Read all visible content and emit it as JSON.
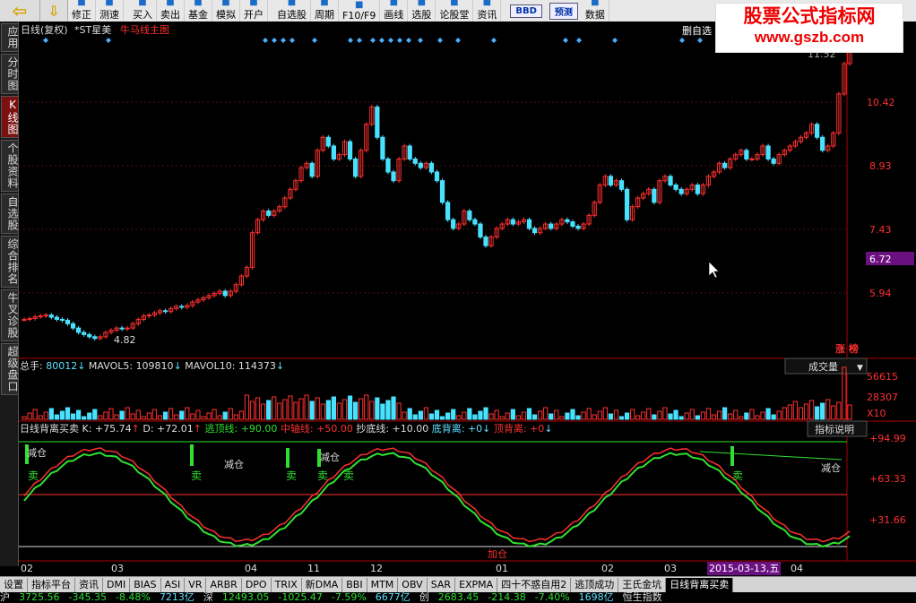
{
  "toolbar": {
    "buttons": [
      {
        "label": "修正",
        "icon": "edit-icon"
      },
      {
        "label": "测速",
        "icon": "speed-icon"
      },
      {
        "label": "买入",
        "icon": "buy-icon"
      },
      {
        "label": "卖出",
        "icon": "sell-icon"
      },
      {
        "label": "基金",
        "icon": "fund-icon"
      },
      {
        "label": "模拟",
        "icon": "simulate-icon"
      },
      {
        "label": "开户",
        "icon": "account-icon"
      },
      {
        "label": "自选股",
        "icon": "watchlist-icon"
      },
      {
        "label": "周期",
        "icon": "period-icon"
      },
      {
        "label": "F10/F9",
        "icon": "f10-icon"
      },
      {
        "label": "画线",
        "icon": "draw-icon"
      },
      {
        "label": "选股",
        "icon": "screen-icon"
      },
      {
        "label": "论股堂",
        "icon": "forum-icon"
      },
      {
        "label": "资讯",
        "icon": "news-icon"
      },
      {
        "label": "BBD",
        "icon": "bbd-icon"
      },
      {
        "label": "预测",
        "icon": "forecast-icon"
      },
      {
        "label": "数据",
        "icon": "data-icon"
      }
    ]
  },
  "logo": {
    "line1": "股票公式指标网",
    "line2": "www.gszb.com"
  },
  "sidebar": {
    "items": [
      {
        "label": "应用",
        "active": false
      },
      {
        "label": "分时图",
        "active": false
      },
      {
        "label": "K线图",
        "active": true
      },
      {
        "label": "个股资料",
        "active": false
      },
      {
        "label": "自选股",
        "active": false
      },
      {
        "label": "综合排名",
        "active": false
      },
      {
        "label": "牛叉诊股",
        "active": false
      },
      {
        "label": "超级盘口",
        "active": false
      }
    ]
  },
  "main": {
    "header_left": "日线(复权)",
    "stock_name": "*ST星美",
    "indicator_name": "牛马线主图",
    "header_right": "删自选",
    "price_labels": [
      "10.42",
      "8.93",
      "7.43",
      "5.94"
    ],
    "current_price": "6.72",
    "low_marker": "4.82",
    "high_marker": "11.52",
    "zhangbang": "涨 榜"
  },
  "volume": {
    "total_label": "总手",
    "total": "80012",
    "mavol5_label": "MAVOL5",
    "mavol5": "109810",
    "mavol10_label": "MAVOL10",
    "mavol10": "114373",
    "dropdown": "成交量",
    "axis": [
      "56615",
      "28307",
      "X10"
    ]
  },
  "indicator": {
    "name": "日线背离买卖",
    "k_label": "K",
    "k": "+75.74",
    "d_label": "D",
    "d": "+72.01",
    "escape_label": "逃顶线",
    "escape": "+90.00",
    "mid_label": "中轴线",
    "mid": "+50.00",
    "bottom_label": "抄底线",
    "bottom": "+10.00",
    "div_bottom_label": "底背离",
    "div_bottom": "+0",
    "div_top_label": "顶背离",
    "div_top": "+0",
    "help": "指标说明",
    "axis": [
      "+94.99",
      "+63.33",
      "+31.66"
    ],
    "annotations": [
      "减仓",
      "卖",
      "卖",
      "减仓",
      "卖",
      "卖",
      "减仓",
      "卖",
      "加仓",
      "卖",
      "减仓"
    ]
  },
  "time_axis": {
    "labels": [
      "02",
      "03",
      "04",
      "11",
      "12",
      "01",
      "02",
      "03",
      "04"
    ],
    "highlight": "2015-03-13,五"
  },
  "bottom_tabs": [
    "设置",
    "指标平台",
    "资讯",
    "DMI",
    "BIAS",
    "ASI",
    "VR",
    "ARBR",
    "DPO",
    "TRIX",
    "新DMA",
    "BBI",
    "MTM",
    "OBV",
    "SAR",
    "EXPMA",
    "四十不惑自用2",
    "逃顶成功",
    "王氏金坑",
    "日线背离买卖"
  ],
  "status": [
    {
      "text": "沪",
      "cls": ""
    },
    {
      "text": "3725.56",
      "cls": "dn"
    },
    {
      "text": "-345.35",
      "cls": "dn"
    },
    {
      "text": "-8.48%",
      "cls": "dn"
    },
    {
      "text": "7213亿",
      "cls": "cy"
    },
    {
      "text": "深",
      "cls": ""
    },
    {
      "text": "12493.05",
      "cls": "dn"
    },
    {
      "text": "-1025.47",
      "cls": "dn"
    },
    {
      "text": "-7.59%",
      "cls": "dn"
    },
    {
      "text": "6677亿",
      "cls": "cy"
    },
    {
      "text": "创",
      "cls": ""
    },
    {
      "text": "2683.45",
      "cls": "dn"
    },
    {
      "text": "-214.38",
      "cls": "dn"
    },
    {
      "text": "-7.40%",
      "cls": "dn"
    },
    {
      "text": "1698亿",
      "cls": "cy"
    },
    {
      "text": "恒生指数",
      "cls": ""
    }
  ],
  "colors": {
    "up": "#ff3030",
    "down": "#48e2ff",
    "axis": "#aa0000",
    "kline": "#ff3030",
    "dline": "#30e030"
  },
  "chart_data": {
    "type": "candlestick",
    "price_range": [
      4.4,
      11.8
    ],
    "closes": [
      5.3,
      5.32,
      5.36,
      5.38,
      5.4,
      5.35,
      5.3,
      5.28,
      5.2,
      5.1,
      5.0,
      4.95,
      4.9,
      4.86,
      4.9,
      5.0,
      5.05,
      5.1,
      5.08,
      5.1,
      5.2,
      5.3,
      5.38,
      5.4,
      5.45,
      5.5,
      5.48,
      5.55,
      5.6,
      5.58,
      5.62,
      5.7,
      5.75,
      5.8,
      5.85,
      5.9,
      5.95,
      5.85,
      5.95,
      6.1,
      6.3,
      6.5,
      7.3,
      7.6,
      7.8,
      7.7,
      7.8,
      7.9,
      8.1,
      8.3,
      8.5,
      8.8,
      8.9,
      8.6,
      9.2,
      9.5,
      9.3,
      9.0,
      9.1,
      9.4,
      9.0,
      8.6,
      9.2,
      9.8,
      10.2,
      9.5,
      9.0,
      8.7,
      8.5,
      9.0,
      9.3,
      9.0,
      8.9,
      8.8,
      8.9,
      8.7,
      8.5,
      8.0,
      7.6,
      7.4,
      7.5,
      7.8,
      7.6,
      7.5,
      7.2,
      7.0,
      7.2,
      7.4,
      7.5,
      7.6,
      7.5,
      7.55,
      7.6,
      7.4,
      7.3,
      7.4,
      7.5,
      7.4,
      7.5,
      7.6,
      7.55,
      7.45,
      7.4,
      7.5,
      7.7,
      8.0,
      8.4,
      8.6,
      8.4,
      8.5,
      8.3,
      7.6,
      7.9,
      8.1,
      8.2,
      8.3,
      8.0,
      8.5,
      8.6,
      8.4,
      8.3,
      8.2,
      8.3,
      8.4,
      8.2,
      8.4,
      8.6,
      8.7,
      8.9,
      8.8,
      9.0,
      9.1,
      9.2,
      9.0,
      9.0,
      9.1,
      9.3,
      9.0,
      8.9,
      9.1,
      9.2,
      9.3,
      9.4,
      9.5,
      9.6,
      9.8,
      9.5,
      9.2,
      9.3,
      9.6,
      10.5,
      11.2,
      11.52
    ]
  }
}
